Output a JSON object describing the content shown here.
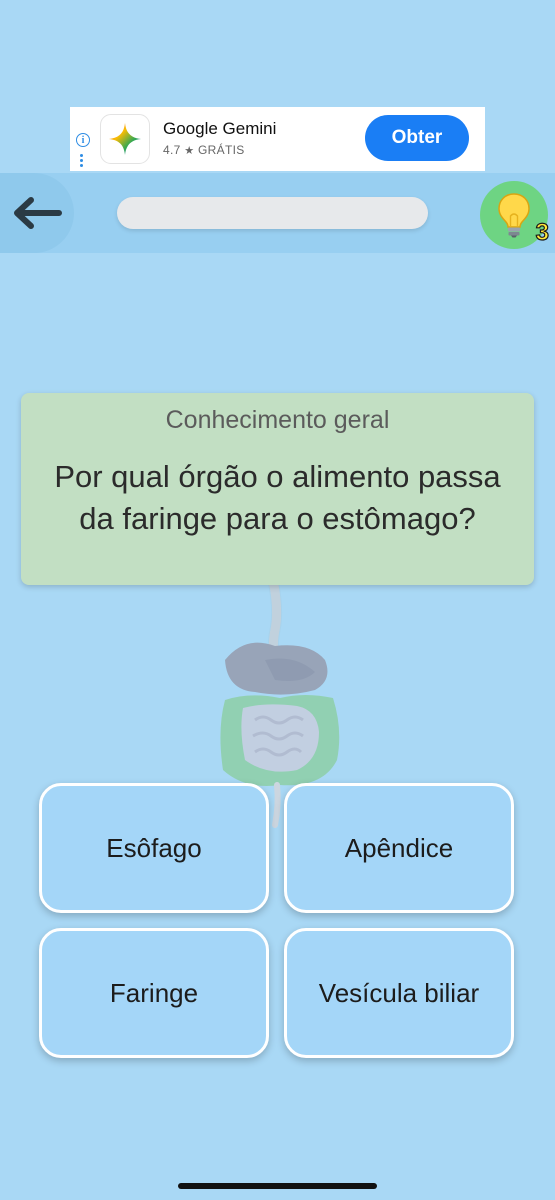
{
  "ad": {
    "app_name": "Google Gemini",
    "rating": "4.7",
    "price": "GRÁTIS",
    "cta_label": "Obter",
    "info_glyph": "i",
    "icon": "gemini-star-icon"
  },
  "topbar": {
    "back_icon": "arrow-left-icon",
    "progress": 0,
    "hint_icon": "lightbulb-icon",
    "hint_count": "3"
  },
  "question": {
    "category": "Conhecimento geral",
    "text": "Por qual órgão o alimento passa da faringe para o estômago?",
    "illustration": "digestive-system-icon"
  },
  "answers": [
    {
      "label": "Esôfago"
    },
    {
      "label": "Apêndice"
    },
    {
      "label": "Faringe"
    },
    {
      "label": "Vesícula biliar"
    }
  ],
  "colors": {
    "background": "#a9d8f5",
    "card": "#c2dfc3",
    "answer": "#a4d6f8",
    "hint": "#6ed483",
    "cta": "#1a7ef5"
  }
}
